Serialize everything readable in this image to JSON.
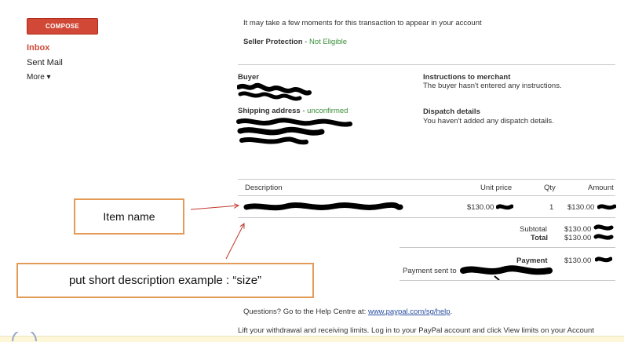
{
  "sidebar": {
    "compose_label": "COMPOSE",
    "inbox_label": "Inbox",
    "sent_label": "Sent Mail",
    "more_label": "More ▾"
  },
  "email": {
    "notice": "It may take a few moments for this transaction to appear in your account",
    "seller_protection_label": "Seller Protection",
    "seller_protection_sep": " - ",
    "seller_protection_value": "Not Eligible",
    "buyer_label": "Buyer",
    "shipping_label": "Shipping address",
    "shipping_sep": " - ",
    "shipping_status": "unconfirmed",
    "instructions_title": "Instructions to merchant",
    "instructions_text": "The buyer hasn't entered any instructions.",
    "dispatch_title": "Dispatch details",
    "dispatch_text": "You haven't added any dispatch details.",
    "table": {
      "col_description": "Description",
      "col_unit_price": "Unit price",
      "col_qty": "Qty",
      "col_amount": "Amount",
      "row_unit_price": "$130.00",
      "row_qty": "1",
      "row_amount": "$130.00"
    },
    "subtotal_label": "Subtotal",
    "subtotal_value": "$130.00",
    "total_label": "Total",
    "total_value": "$130.00",
    "payment_label": "Payment",
    "payment_value": "$130.00",
    "payment_sent_label": "Payment sent to",
    "questions_text": "Questions? Go to the Help Centre at: ",
    "help_link": "www.paypal.com/sg/help",
    "help_suffix": ".",
    "limits_text": "Lift your withdrawal and receiving limits. Log in to your PayPal account and click View limits on your Account"
  },
  "annotations": {
    "item_name": "Item name",
    "short_description": "put short description example : “size”"
  },
  "colors": {
    "compose": "#d14836",
    "green": "#3a8e3a",
    "annotation_border": "#e39b57",
    "arrow": "#c0392b"
  }
}
